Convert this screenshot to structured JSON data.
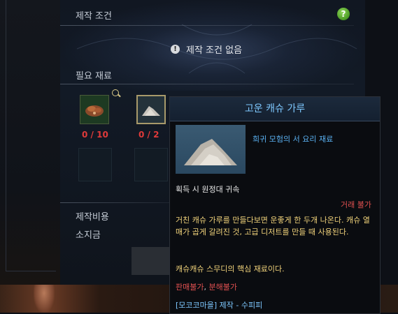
{
  "crafting": {
    "conditions_title": "제작 조건",
    "help_icon_label": "?",
    "no_conditions": "제작 조건 없음",
    "materials_title": "필요 재료",
    "materials": [
      {
        "count": "0 / 10",
        "icon": "meat-icon"
      },
      {
        "count": "0 / 2",
        "icon": "powder-icon"
      }
    ],
    "cost_label": "제작비용",
    "money_label": "소지금"
  },
  "tooltip": {
    "title": "고운 캐슈 가루",
    "category": "희귀 모험의 서 요리 재료",
    "bound": "획득 시 원정대 귀속",
    "trade": "거래 불가",
    "description": "거친 캐슈 가루를 만들다보면 운좋게 한 두개 나온다. 캐슈 열매가 곱게 갈려진 것, 고급 디저트를 만들 때 사용된다.",
    "core": "캐슈캐슈 스무디의 핵심 재료이다.",
    "flag_sell": "판매불가",
    "flag_sep": ", ",
    "flag_disassemble": "분해불가",
    "source": "[모코코마을] 제작 - 수피피"
  },
  "colors": {
    "accent_blue": "#7ec8ff",
    "warning_red": "#e05050",
    "lore_gold": "#f0d27a"
  }
}
